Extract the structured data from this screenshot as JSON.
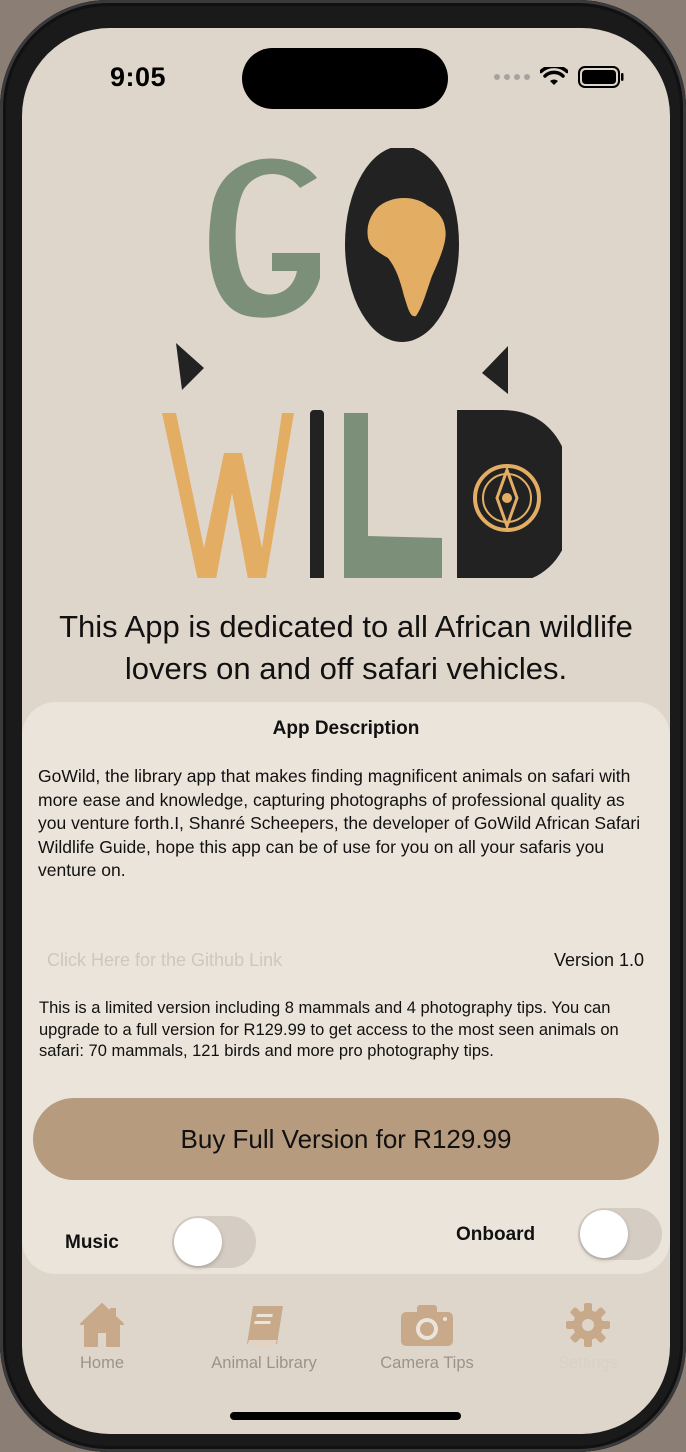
{
  "status_bar": {
    "time": "9:05"
  },
  "logo": {
    "line1": "GO",
    "line2": "WILD"
  },
  "tagline": "This App is dedicated to all African wildlife lovers on and off safari vehicles.",
  "card": {
    "title": "App Description",
    "description": "GoWild, the library app that makes finding magnificent animals on safari with more ease and knowledge, capturing photographs of professional quality as you venture forth.I, Shanré Scheepers, the developer of GoWild African Safari Wildlife Guide, hope this app can be of use for you on all your safaris you venture on.",
    "github_link": "Click Here for the Github Link",
    "version": "Version 1.0",
    "limited_text": "This is a limited version including 8 mammals and 4 photography tips. You can upgrade to a full version for R129.99 to get access to the most seen animals on safari: 70 mammals, 121 birds and more pro photography tips.",
    "buy_button": "Buy Full Version for R129.99",
    "music_label": "Music",
    "music_on": false,
    "onboard_label": "Onboard",
    "onboard_on": false
  },
  "tabs": [
    {
      "label": "Home",
      "icon": "home-icon"
    },
    {
      "label": "Animal Library",
      "icon": "book-icon"
    },
    {
      "label": "Camera Tips",
      "icon": "camera-icon"
    },
    {
      "label": "Settings",
      "icon": "gear-icon"
    }
  ],
  "colors": {
    "background": "#dfd6cb",
    "card": "#ebe4da",
    "button": "#b79b7e",
    "logo_green": "#7b8f79",
    "logo_gold": "#e3ae63",
    "logo_dark": "#222222"
  }
}
